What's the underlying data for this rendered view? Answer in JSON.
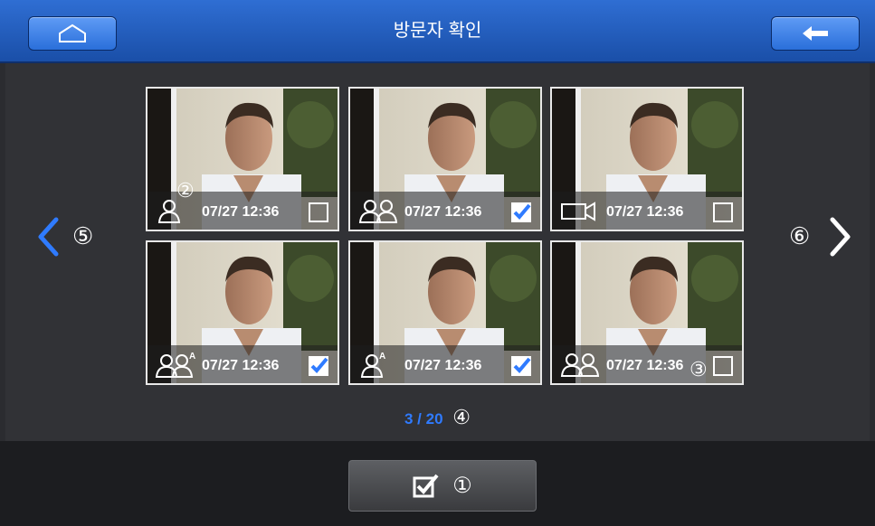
{
  "header": {
    "title": "방문자 확인",
    "home_icon": "home-icon",
    "back_icon": "back-arrow-icon"
  },
  "nav": {
    "prev_marker": "⑤",
    "next_marker": "⑥"
  },
  "thumbnails": [
    {
      "time": "07/27 12:36",
      "type_icon": "single-person-icon",
      "checked": false,
      "marker": "②"
    },
    {
      "time": "07/27 12:36",
      "type_icon": "two-persons-icon",
      "checked": true
    },
    {
      "time": "07/27 12:36",
      "type_icon": "video-camera-icon",
      "checked": false
    },
    {
      "time": "07/27 12:36",
      "type_icon": "two-persons-a-icon",
      "type_label": "A",
      "checked": true
    },
    {
      "time": "07/27 12:36",
      "type_icon": "single-person-a-icon",
      "type_label": "A",
      "checked": true
    },
    {
      "time": "07/27 12:36",
      "type_icon": "two-persons-icon",
      "checked": false,
      "marker": "③"
    }
  ],
  "pager": {
    "current": "3",
    "separator": " / ",
    "total": "20",
    "marker": "④"
  },
  "colors": {
    "accent": "#2f7bff",
    "header": "#2a63c4"
  },
  "confirm": {
    "icon": "checkbox-icon",
    "marker": "①"
  }
}
